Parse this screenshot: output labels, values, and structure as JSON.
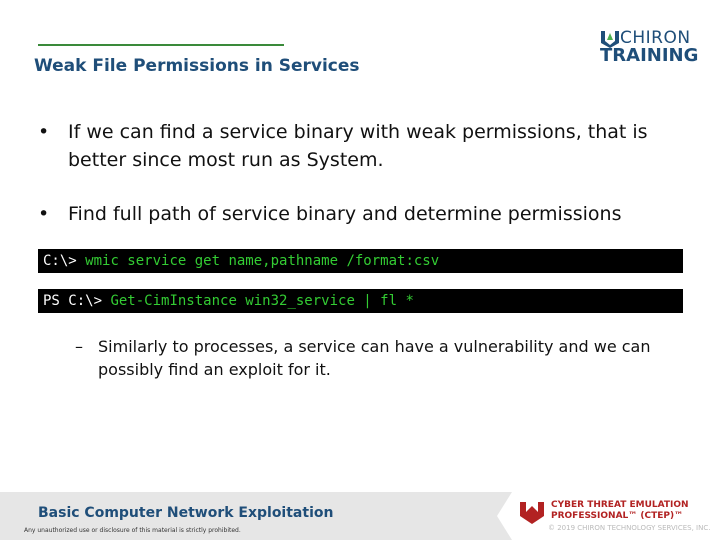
{
  "header": {
    "title": "Weak File Permissions in Services",
    "logo_line1": "CHIRON",
    "logo_line2": "TRAINING"
  },
  "bullets": [
    {
      "text": "If we can find a service binary with weak permissions, that is better since most run as System."
    },
    {
      "text": "Find full path of service binary and determine permissions"
    }
  ],
  "bullet_symbol": "•",
  "code_blocks": [
    {
      "prompt": "C:\\> ",
      "command": "wmic service get name,pathname /format:csv"
    },
    {
      "prompt": "PS C:\\> ",
      "command": "Get-CimInstance win32_service | fl *"
    }
  ],
  "sub_bullet": {
    "symbol": "–",
    "text": "Similarly to processes, a service can have a vulnerability and we can possibly find an exploit for it."
  },
  "footer": {
    "course": "Basic Computer Network Exploitation",
    "notice": "Any unauthorized use or disclosure of this material is strictly prohibited.",
    "ctep_line1": "CYBER THREAT EMULATION",
    "ctep_line2": "PROFESSIONAL™ (CTEP)™",
    "copyright": "© 2019 CHIRON TECHNOLOGY SERVICES, INC."
  },
  "colors": {
    "title": "#1f4e79",
    "rule": "#3a8a3a",
    "code_bg": "#000000",
    "code_command": "#33cc33",
    "ctep": "#b22222"
  }
}
